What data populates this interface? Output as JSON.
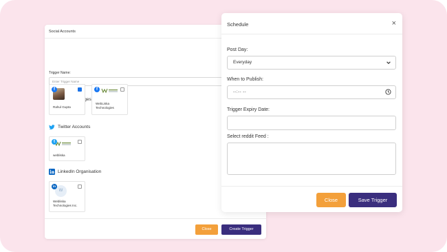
{
  "social": {
    "header_title": "Social Accounts",
    "trigger_name_label": "Trigger Name:",
    "trigger_name_placeholder": "Enter Trigger Name",
    "sections": {
      "facebook": "Facebook Pages",
      "twitter": "Twitter Accounts",
      "linkedin": "LinkedIn Organisation"
    },
    "cards": {
      "fb1": {
        "name": "Rahul Gupta",
        "checked": true
      },
      "fb2": {
        "name_line1": "WebLiska",
        "name_line2": "Technologies",
        "checked": false
      },
      "tw1": {
        "name": "webliska",
        "checked": false
      },
      "li1": {
        "name_line1": "Webliska",
        "name_line2": "Technologies Inc.",
        "checked": false,
        "avatar_letter": "W"
      }
    },
    "logo_text": "WEBLISKA\nTECHNOLOGIES",
    "close_label": "Close",
    "create_label": "Create Trigger"
  },
  "schedule": {
    "title": "Schedule",
    "close_icon": "×",
    "post_day_label": "Post Day:",
    "post_day_value": "Everyday",
    "when_label": "When to Publish:",
    "when_value": "--:-- --",
    "expiry_label": "Trigger Expiry Date:",
    "feed_label": "Select reddit Feed :",
    "close_label": "Close",
    "save_label": "Save Trigger"
  },
  "colors": {
    "background": "#fbe4ec",
    "orange": "#f3a03b",
    "purple": "#3a2e7e",
    "facebook": "#1877f2",
    "twitter": "#1da1f2",
    "linkedin": "#0a66c2"
  },
  "icons": {
    "facebook_section": "flag-icon",
    "twitter_section": "twitter-bird-icon",
    "linkedin_section": "linkedin-icon",
    "close": "close-icon",
    "chevron": "chevron-down-icon",
    "clock": "clock-icon"
  }
}
